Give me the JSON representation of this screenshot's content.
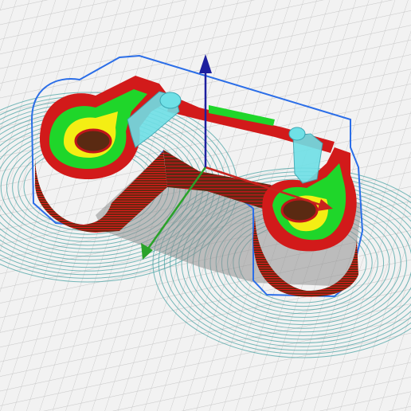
{
  "viewport": {
    "label": "",
    "background_color": "#f2f2f2",
    "grid_color": "#c8c8c8"
  },
  "part": {
    "outline_color": "#2b6ee8",
    "wall_color": "#5a2a12",
    "wall_line_color": "#c0151a",
    "top_fill_color": "#d21a1a",
    "inner_fill_color": "#1fd62a",
    "core_fill_color": "#f4ee14",
    "support_color": "#6fe0e6",
    "skirt_color": "#3f9ea0",
    "shadow_color": "#8f8f8f"
  },
  "gizmo": {
    "x_axis_color": "#c8241f",
    "y_axis_color": "#2aa22a",
    "z_axis_color": "#1d1f9f"
  },
  "icons": [
    "move-gizmo-icon"
  ]
}
